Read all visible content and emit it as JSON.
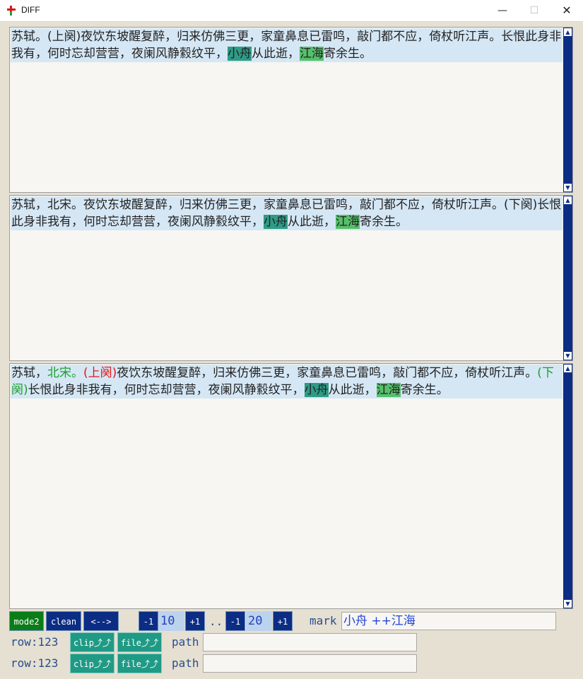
{
  "window": {
    "title": "DIFF",
    "min": "—",
    "max": "☐",
    "close": "✕"
  },
  "pane1": {
    "segments": [
      {
        "text": "苏轼。(上阕)夜饮东坡醒复醉，归来仿佛三更，家童鼻息已雷鸣，敲门都不应，倚杖听江声。长恨此身非我有，何时忘却营营，夜阑风静縠纹平，",
        "style": ""
      },
      {
        "text": "小舟",
        "style": "hl-teal"
      },
      {
        "text": "从此逝，",
        "style": ""
      },
      {
        "text": "江海",
        "style": "hl-green"
      },
      {
        "text": "寄余生。",
        "style": ""
      }
    ]
  },
  "pane2": {
    "segments": [
      {
        "text": "苏轼，北宋。夜饮东坡醒复醉，归来仿佛三更，家童鼻息已雷鸣，敲门都不应，倚杖听江声。(下阕)长恨此身非我有，何时忘却营营，夜阑风静縠纹平，",
        "style": ""
      },
      {
        "text": "小舟",
        "style": "hl-teal"
      },
      {
        "text": "从此逝，",
        "style": ""
      },
      {
        "text": "江海",
        "style": "hl-green"
      },
      {
        "text": "寄余生。",
        "style": ""
      }
    ]
  },
  "pane3": {
    "segments": [
      {
        "text": "苏轼，",
        "style": ""
      },
      {
        "text": "北宋。",
        "style": "c-green"
      },
      {
        "text": "(上阕)",
        "style": "c-red"
      },
      {
        "text": "夜饮东坡醒复醉，归来仿佛三更，家童鼻息已雷鸣，敲门都不应，倚杖听江声。",
        "style": ""
      },
      {
        "text": "(下阕)",
        "style": "c-green"
      },
      {
        "text": "长恨此身非我有，何时忘却营营，夜阑风静縠纹平，",
        "style": ""
      },
      {
        "text": "小舟",
        "style": "hl-teal"
      },
      {
        "text": "从此逝，",
        "style": ""
      },
      {
        "text": "江海",
        "style": "hl-green"
      },
      {
        "text": "寄余生。",
        "style": ""
      }
    ]
  },
  "scroll": {
    "up": "▲",
    "down": "▼"
  },
  "toolbar": {
    "mode_label": "mode2",
    "clean_label": "clean",
    "swap_label": "<-->",
    "range1": {
      "minus": "-1",
      "value": "10",
      "plus": "+1"
    },
    "range_sep": "..",
    "range2": {
      "minus": "-1",
      "value": "20",
      "plus": "+1"
    },
    "mark_label": "mark",
    "mark_value": "小舟 ++江海"
  },
  "rows": [
    {
      "row_label": "row:123",
      "clip_label": "clip⤴⤴",
      "file_label": "file⤴⤴",
      "path_label": "path",
      "path_value": ""
    },
    {
      "row_label": "row:123",
      "clip_label": "clip⤴⤴",
      "file_label": "file⤴⤴",
      "path_label": "path",
      "path_value": ""
    }
  ],
  "colors": {
    "accent_navy": "#0c2d84",
    "highlight_teal": "#2e9b86",
    "highlight_green": "#55c06a",
    "diff_red": "#e01818",
    "diff_green": "#1aa02a"
  }
}
